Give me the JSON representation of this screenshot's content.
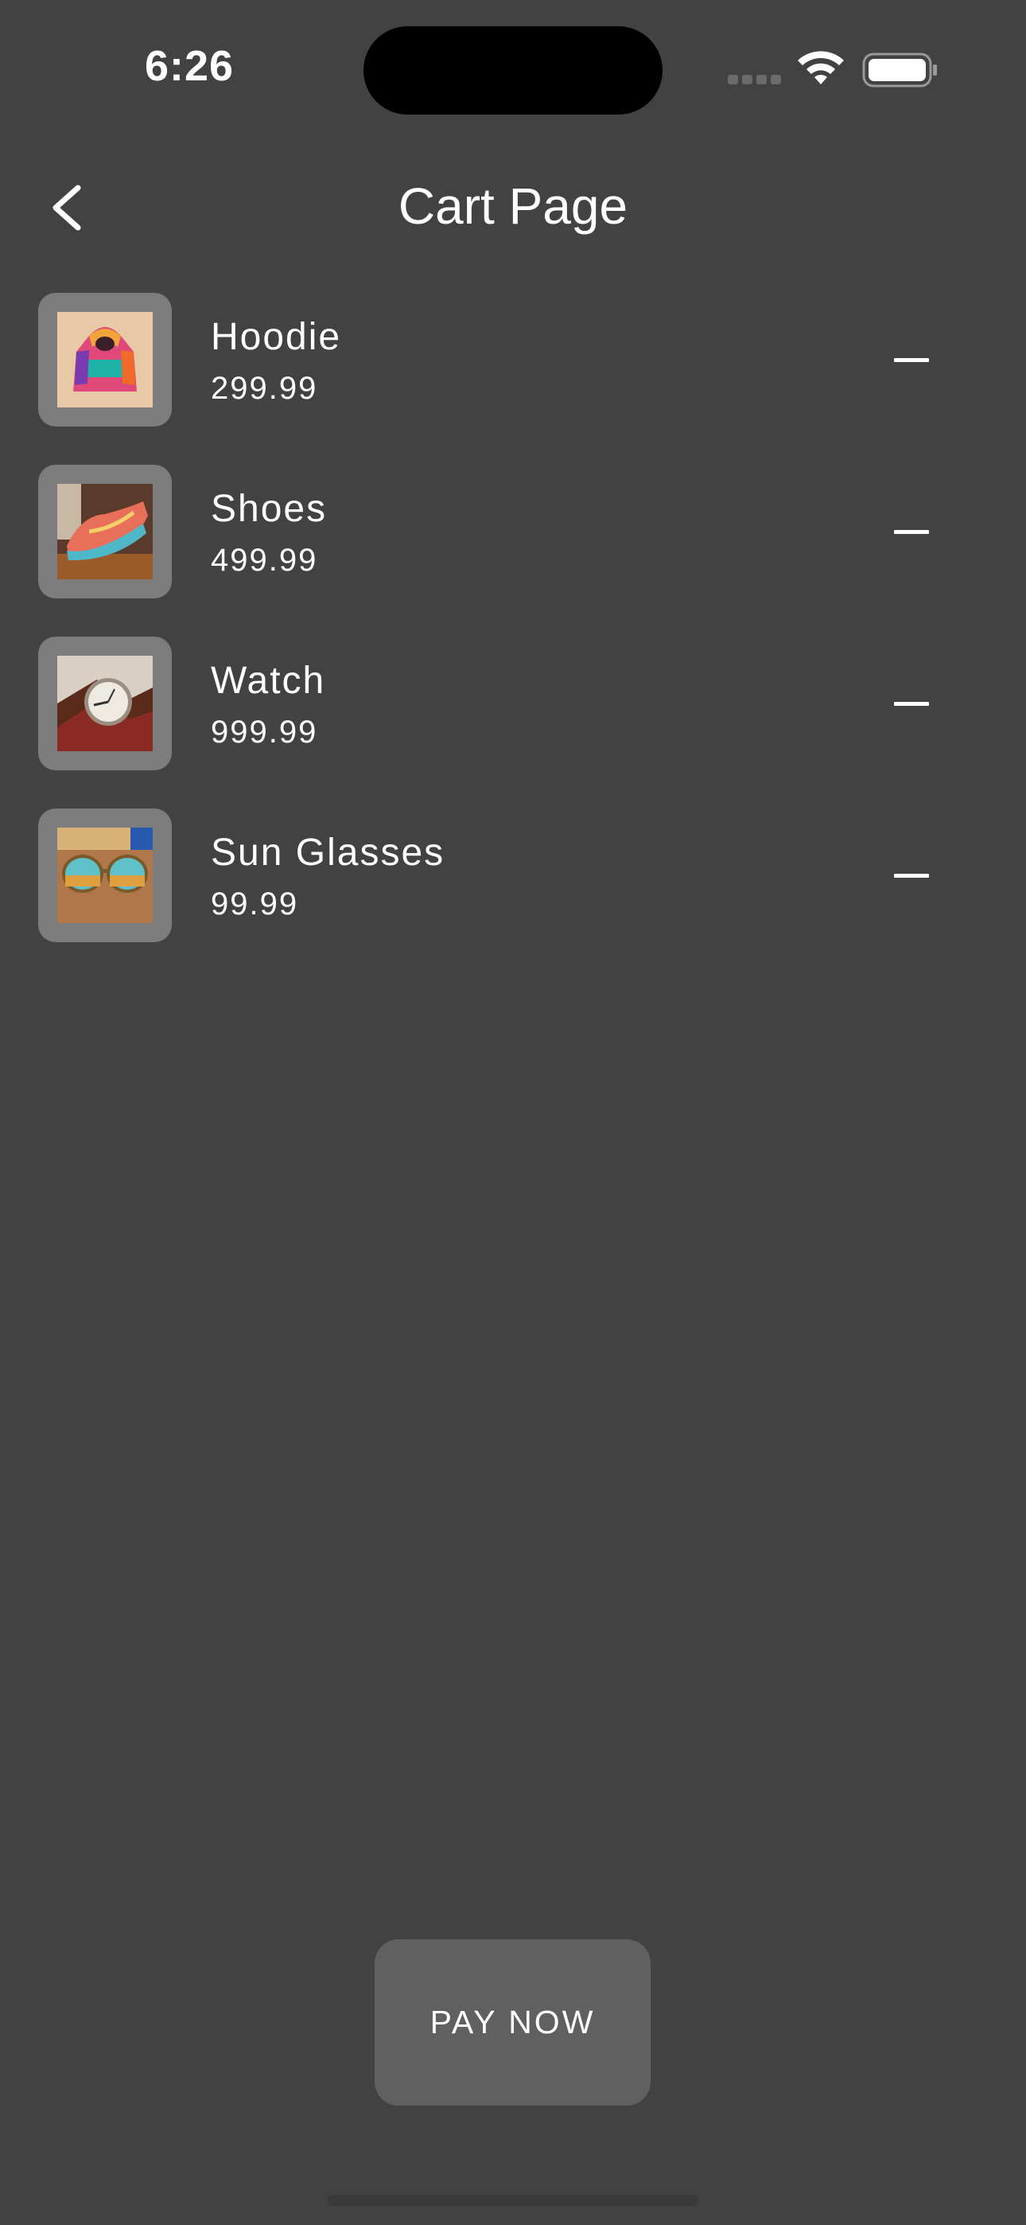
{
  "status_bar": {
    "time": "6:26"
  },
  "header": {
    "title": "Cart Page",
    "back_icon": "chevron-left-icon"
  },
  "cart": {
    "items": [
      {
        "name": "Hoodie",
        "price": "299.99",
        "image": "hoodie-image"
      },
      {
        "name": "Shoes",
        "price": "499.99",
        "image": "shoes-image"
      },
      {
        "name": "Watch",
        "price": "999.99",
        "image": "watch-image"
      },
      {
        "name": "Sun Glasses",
        "price": "99.99",
        "image": "sunglasses-image"
      }
    ],
    "remove_icon": "minus-icon"
  },
  "actions": {
    "pay_label": "PAY NOW"
  },
  "colors": {
    "background": "#424242",
    "thumb_bg": "#7d7d7d",
    "button_bg": "#606060",
    "text": "#ffffff"
  }
}
